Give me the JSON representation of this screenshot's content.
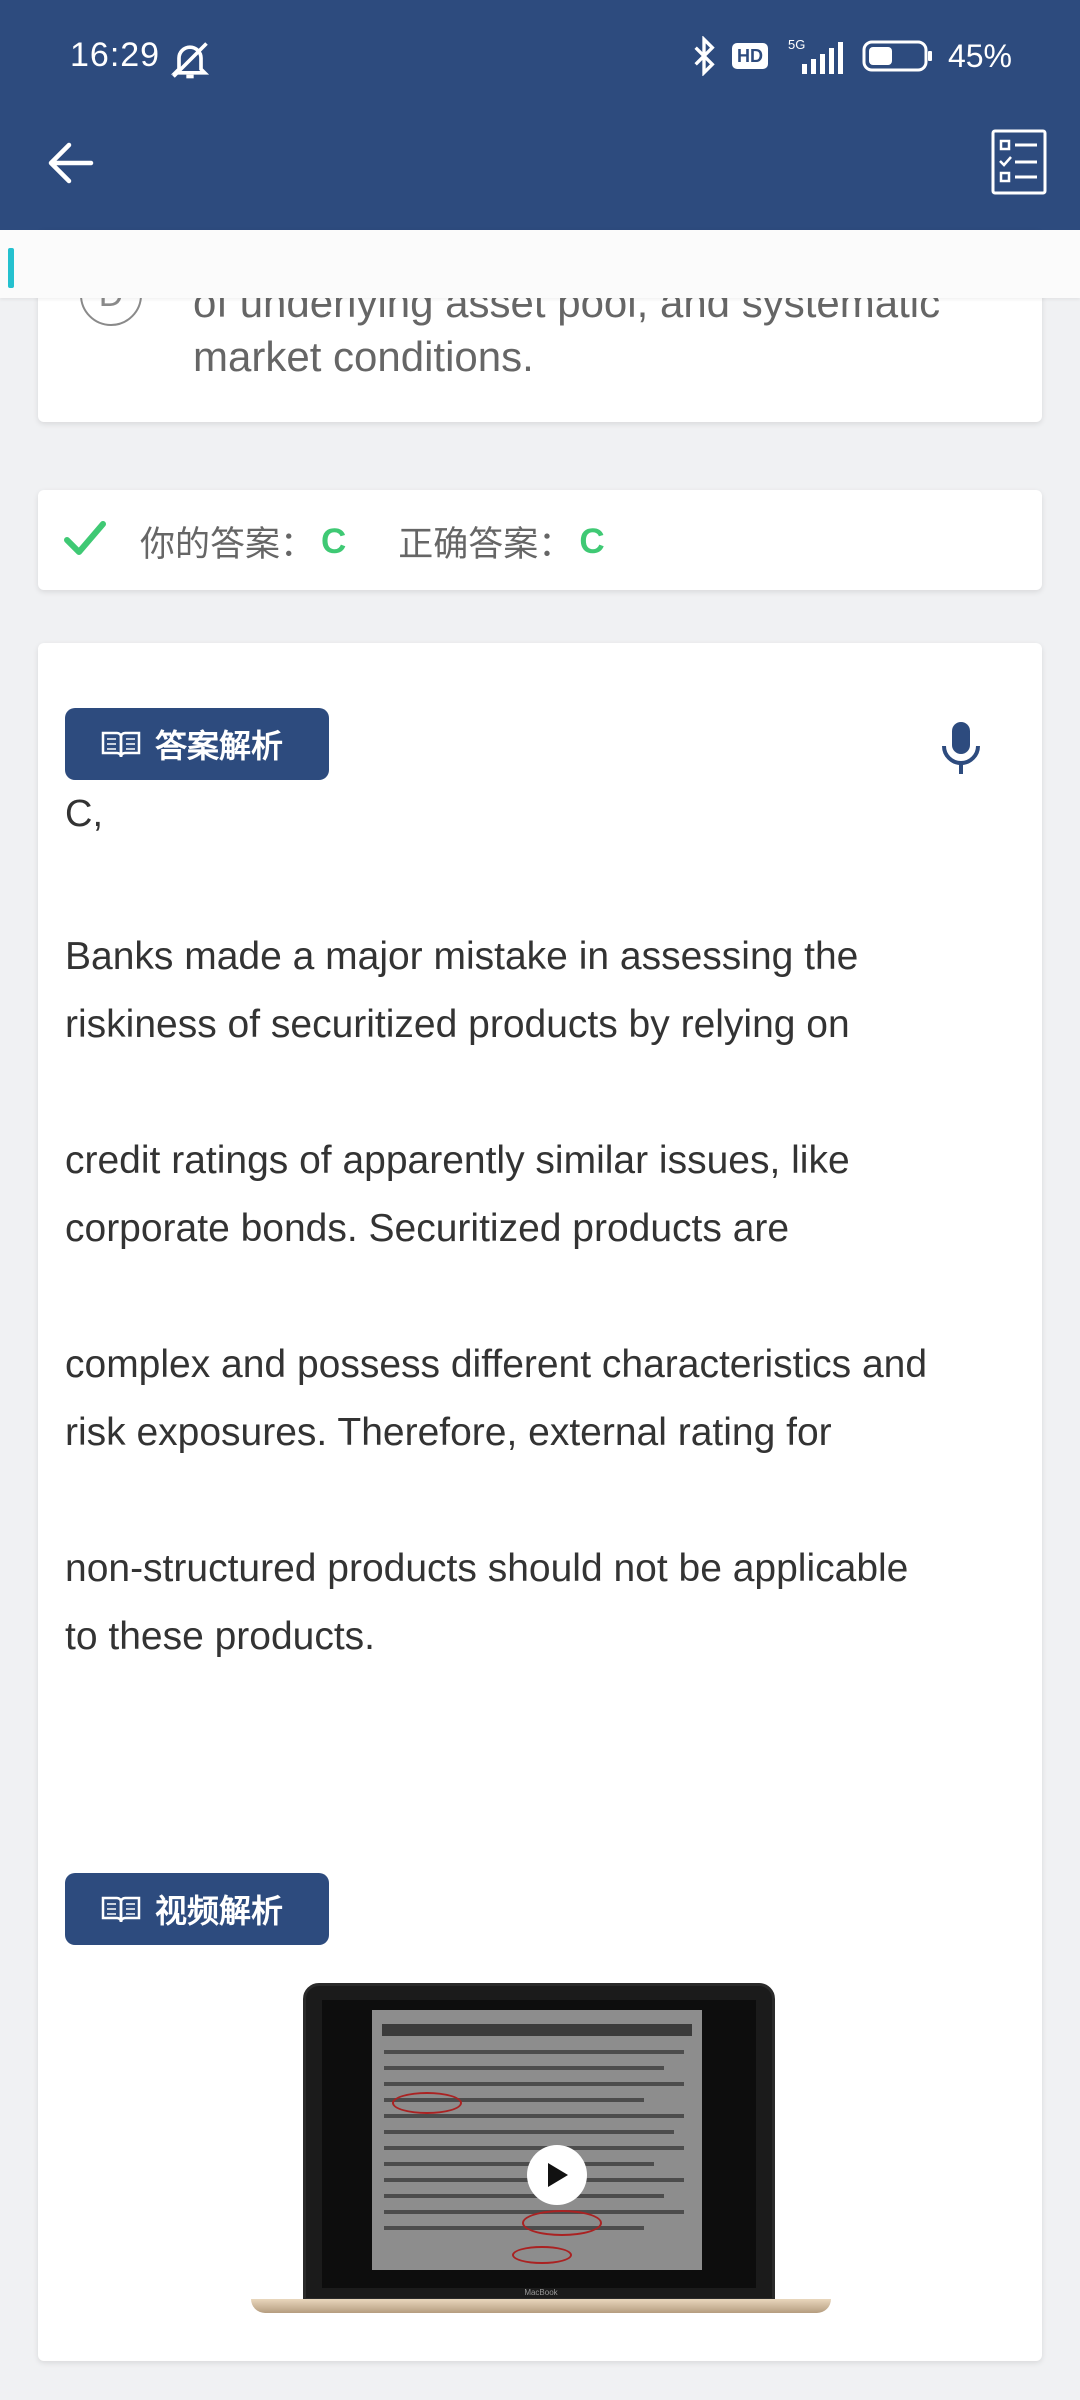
{
  "status_bar": {
    "time": "16:29",
    "hd": "HD",
    "network": "5G",
    "battery": "45%",
    "battery_level": 0.45
  },
  "toolbar": {
    "back_icon": "arrow-left-icon",
    "list_icon": "checklist-icon"
  },
  "option_d": {
    "letter": "D",
    "text": "of underlying asset pool, and systematic market conditions."
  },
  "answer": {
    "your_label": "你的答案：",
    "your_value": "C",
    "correct_label": "正确答案：",
    "correct_value": "C"
  },
  "explanation": {
    "section_label": "答案解析",
    "head": "C,",
    "lines": [
      "Banks made a major mistake in assessing the",
      "riskiness of securitized products by relying on",
      "",
      "credit ratings of apparently similar issues, like",
      "corporate bonds. Securitized products are",
      "",
      "complex and possess different characteristics and",
      "risk exposures. Therefore, external rating for",
      "",
      "non-structured products should not be applicable",
      "to these products."
    ]
  },
  "video": {
    "section_label": "视频解析",
    "brand": "MacBook"
  },
  "colors": {
    "primary": "#2d4b7e",
    "correct": "#3fc974",
    "accent": "#25c1cf"
  }
}
